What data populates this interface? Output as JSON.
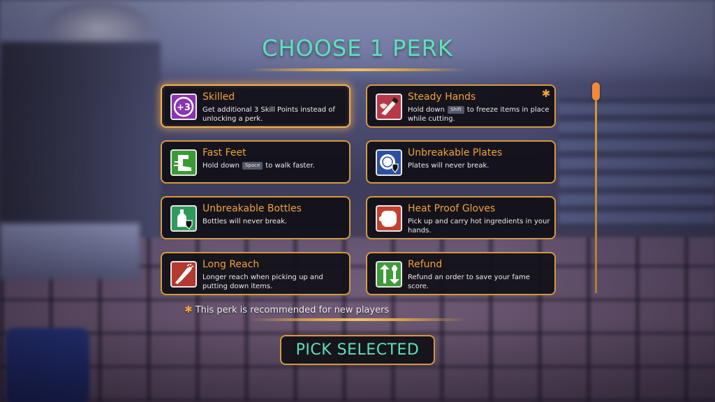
{
  "screen": {
    "title": "CHOOSE 1 PERK",
    "recommended_note": "This perk is recommended for new players",
    "pick_button_label": "PICK SELECTED"
  },
  "colors": {
    "title": "#5ce2b8",
    "perk_name": "#f2a23a",
    "card_border": "#d49a3e",
    "card_bg": "#111018",
    "scroll_thumb": "#f08a3a"
  },
  "perks": [
    {
      "name": "Skilled",
      "desc_pre": "Get additional 3 Skill Points instead of unlocking a perk.",
      "key": "",
      "desc_post": "",
      "icon": "plus-three-icon",
      "selected": true,
      "recommended": false
    },
    {
      "name": "Steady Hands",
      "desc_pre": "Hold down",
      "key": "Shift",
      "desc_post": "to freeze items in place while cutting.",
      "icon": "knife-hand-icon",
      "selected": false,
      "recommended": true
    },
    {
      "name": "Fast Feet",
      "desc_pre": "Hold down",
      "key": "Space",
      "desc_post": "to walk faster.",
      "icon": "foot-icon",
      "selected": false,
      "recommended": false
    },
    {
      "name": "Unbreakable Plates",
      "desc_pre": "Plates will never break.",
      "key": "",
      "desc_post": "",
      "icon": "plate-shield-icon",
      "selected": false,
      "recommended": false
    },
    {
      "name": "Unbreakable Bottles",
      "desc_pre": "Bottles will never break.",
      "key": "",
      "desc_post": "",
      "icon": "bottle-shield-icon",
      "selected": false,
      "recommended": false
    },
    {
      "name": "Heat Proof Gloves",
      "desc_pre": "Pick up and carry hot ingredients in your hands.",
      "key": "",
      "desc_post": "",
      "icon": "glove-icon",
      "selected": false,
      "recommended": false
    },
    {
      "name": "Long Reach",
      "desc_pre": "Longer reach when picking up and putting down items.",
      "key": "",
      "desc_post": "",
      "icon": "arm-reach-icon",
      "selected": false,
      "recommended": false
    },
    {
      "name": "Refund",
      "desc_pre": "Refund an order to save your fame score.",
      "key": "",
      "desc_post": "",
      "icon": "refund-arrows-icon",
      "selected": false,
      "recommended": false
    }
  ]
}
